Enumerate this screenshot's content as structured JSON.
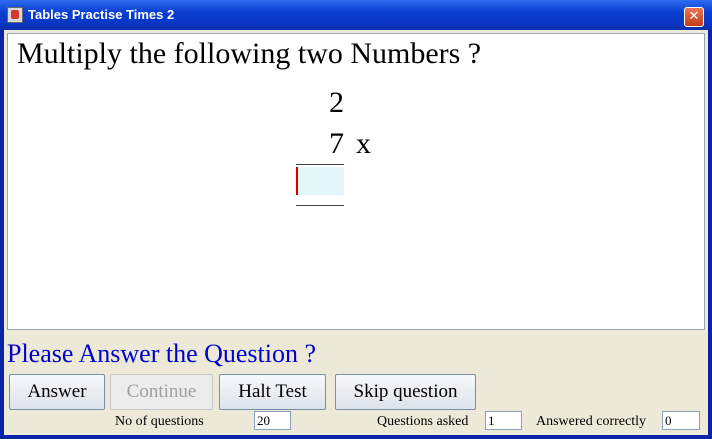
{
  "window": {
    "title": "Tables Practise Times 2",
    "close_symbol": "✕",
    "icon": "java-cup-icon"
  },
  "question": {
    "instruction": "Multiply the following two Numbers ?",
    "first_number": "2",
    "second_number": "7",
    "operator": "x",
    "answer_value": ""
  },
  "status": {
    "message": "Please Answer the Question ?"
  },
  "buttons": {
    "answer": "Answer",
    "continue": "Continue",
    "halt": "Halt Test",
    "skip": "Skip question"
  },
  "stats": {
    "no_of_questions_label": "No of questions",
    "no_of_questions_value": "20",
    "questions_asked_label": "Questions asked",
    "questions_asked_value": "1",
    "answered_correctly_label": "Answered correctly",
    "answered_correctly_value": "0"
  },
  "colors": {
    "status_text": "#0000cc",
    "answer_field_bg": "#e3f7fb",
    "titlebar": "#0a3fd0"
  }
}
